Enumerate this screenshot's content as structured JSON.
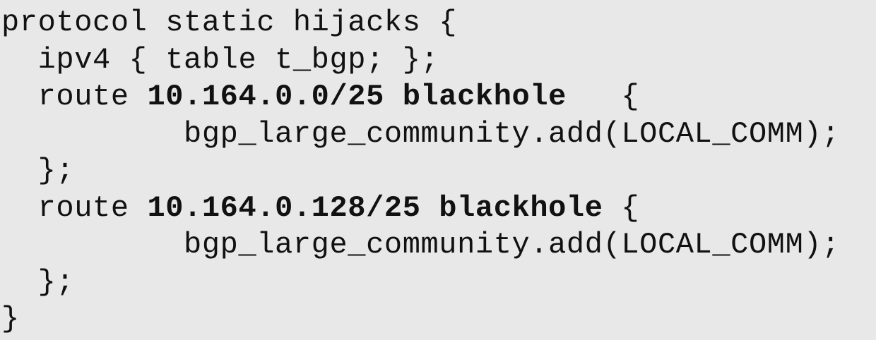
{
  "code": {
    "line1": {
      "text": "protocol static hijacks {"
    },
    "line2": {
      "text": "  ipv4 { table t_bgp; };"
    },
    "line3": {
      "prefix": "  route ",
      "bold": "10.164.0.0/25 blackhole",
      "suffix": "   {"
    },
    "line4": {
      "text": "          bgp_large_community.add(LOCAL_COMM);"
    },
    "line5": {
      "text": "  };"
    },
    "line6": {
      "prefix": "  route ",
      "bold": "10.164.0.128/25 blackhole",
      "suffix": " {"
    },
    "line7": {
      "text": "          bgp_large_community.add(LOCAL_COMM);"
    },
    "line8": {
      "text": "  };"
    },
    "line9": {
      "text": "}"
    }
  }
}
